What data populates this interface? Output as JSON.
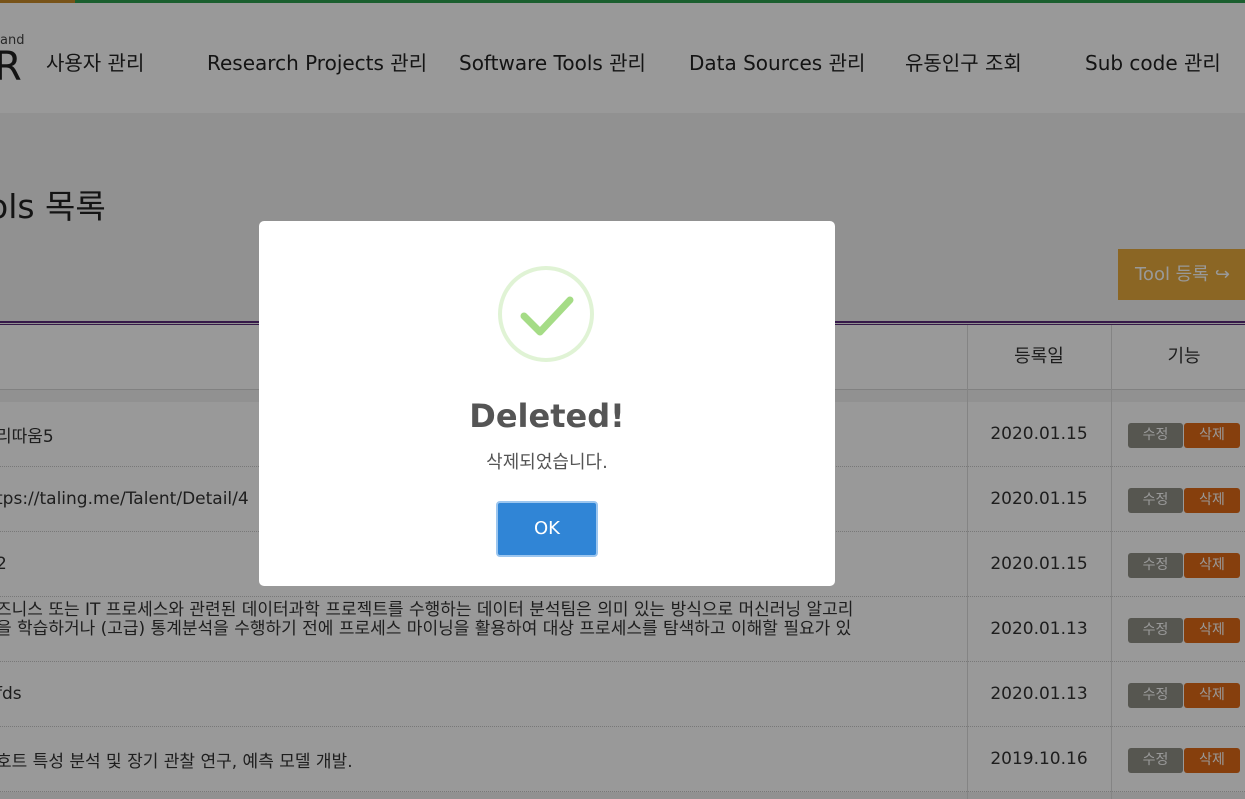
{
  "header": {
    "logo_small": "and",
    "logo_big": "R",
    "nav": [
      "사용자 관리",
      "Research Projects 관리",
      "Software Tools 관리",
      "Data Sources 관리",
      "유동인구 조회",
      "Sub code 관리"
    ]
  },
  "page": {
    "title": "ols 목록",
    "register_button": "Tool 등록",
    "register_icon": "share-arrow-icon"
  },
  "table": {
    "headers": {
      "date": "등록일",
      "actions": "기능"
    },
    "edit_label": "수정",
    "delete_label": "삭제",
    "rows": [
      {
        "title": "리따움5",
        "date": "2020.01.15"
      },
      {
        "title": "tps://taling.me/Talent/Detail/4",
        "date": "2020.01.15"
      },
      {
        "title": "2",
        "date": "2020.01.15"
      },
      {
        "title": "즈니스 또는 IT 프로세스와 관련된 데이터과학 프로젝트를 수행하는 데이터 분석팀은 의미 있는 방식으로 머신러닝 알고리\n을 학습하거나 (고급) 통계분석을 수행하기 전에 프로세스 마이닝을 활용하여 대상 프로세스를 탐색하고 이해할 필요가 있\n.",
        "date": "2020.01.13"
      },
      {
        "title": "fds",
        "date": "2020.01.13"
      },
      {
        "title": "호트 특성 분석 및 장기 관찰 연구, 예측 모델 개발.",
        "date": "2019.10.16"
      }
    ]
  },
  "modal": {
    "icon": "success-check-icon",
    "title": "Deleted!",
    "message": "삭제되었습니다.",
    "ok_label": "OK"
  },
  "colors": {
    "accent_purple": "#5a2b7a",
    "register_orange": "#e8aa3c",
    "delete_orange": "#e06a16",
    "ok_blue": "#3085d6",
    "success_green": "#a5dc86"
  }
}
